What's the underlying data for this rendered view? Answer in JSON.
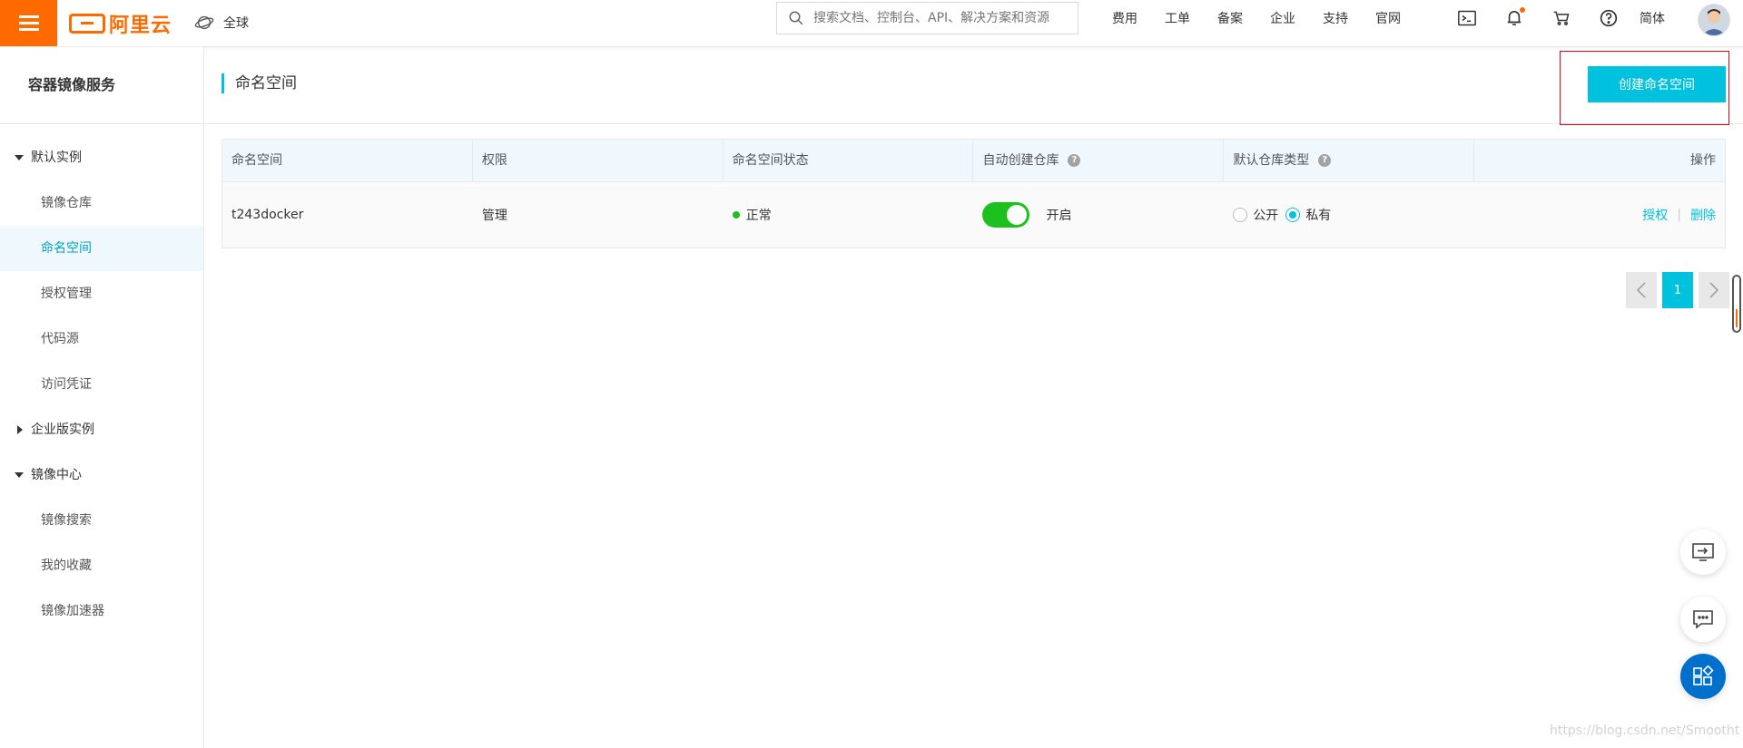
{
  "topbar": {
    "logo_text": "阿里云",
    "region": "全球",
    "search_placeholder": "搜索文档、控制台、API、解决方案和资源",
    "links": [
      "费用",
      "工单",
      "备案",
      "企业",
      "支持",
      "官网"
    ],
    "icons": [
      "terminal-icon",
      "bell-icon",
      "cart-icon",
      "help-icon"
    ],
    "language": "简体"
  },
  "sidebar": {
    "title": "容器镜像服务",
    "groups": [
      {
        "label": "默认实例",
        "expanded": true,
        "items": [
          "镜像仓库",
          "命名空间",
          "授权管理",
          "代码源",
          "访问凭证"
        ]
      },
      {
        "label": "企业版实例",
        "expanded": false,
        "items": []
      },
      {
        "label": "镜像中心",
        "expanded": true,
        "items": [
          "镜像搜索",
          "我的收藏",
          "镜像加速器"
        ]
      }
    ],
    "active_item": "命名空间"
  },
  "page": {
    "title": "命名空间",
    "create_button": "创建命名空间"
  },
  "table": {
    "columns": [
      "命名空间",
      "权限",
      "命名空间状态",
      "自动创建仓库",
      "默认仓库类型",
      "操作"
    ],
    "rows": [
      {
        "name": "t243docker",
        "permission": "管理",
        "status": "正常",
        "auto_create": "开启",
        "auto_create_on": true,
        "repo_type_options": [
          "公开",
          "私有"
        ],
        "repo_type_selected": "私有",
        "actions": [
          "授权",
          "删除"
        ]
      }
    ]
  },
  "pagination": {
    "current": "1"
  },
  "watermark": "https://blog.csdn.net/Smootht",
  "colors": {
    "brand": "#ff6a00",
    "accent": "#00c1de",
    "success": "#1dc11d"
  }
}
